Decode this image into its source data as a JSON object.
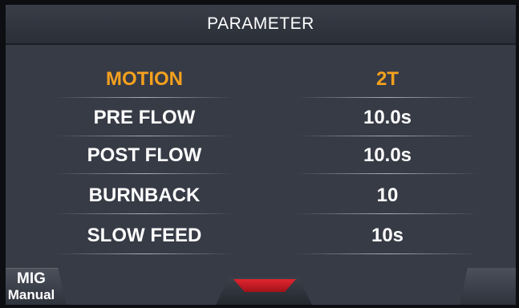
{
  "header": {
    "title": "PARAMETER"
  },
  "parameters": [
    {
      "label": "MOTION",
      "value": "2T",
      "active": true
    },
    {
      "label": "PRE FLOW",
      "value": "10.0s",
      "active": false
    },
    {
      "label": "POST FLOW",
      "value": "10.0s",
      "active": false
    },
    {
      "label": "BURNBACK",
      "value": "10",
      "active": false
    },
    {
      "label": "SLOW FEED",
      "value": "10s",
      "active": false
    }
  ],
  "bottom_bar": {
    "mode_line1": "MIG",
    "mode_line2": "Manual"
  },
  "colors": {
    "background": "#373b46",
    "active_text": "#f5a11e",
    "text": "#ffffff",
    "indicator": "#e0252f"
  }
}
